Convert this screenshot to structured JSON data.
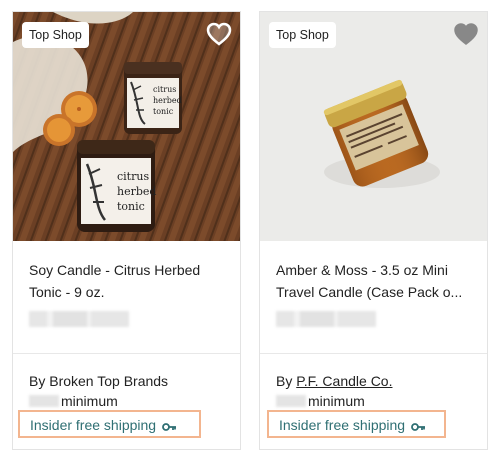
{
  "cards": [
    {
      "badge": "Top Shop",
      "title": "Soy Candle - Citrus Herbed Tonic - 9 oz.",
      "by_label": "By ",
      "brand": "Broken Top Brands",
      "min_label": "minimum",
      "shipping": "Insider free shipping",
      "jar_label_lines": [
        "citrus",
        "herbed",
        "tonic"
      ]
    },
    {
      "badge": "Top Shop",
      "title": "Amber & Moss - 3.5 oz Mini Travel Candle (Case Pack o...",
      "by_label": "By ",
      "brand": "P.F. Candle Co.",
      "min_label": "minimum",
      "shipping": "Insider free shipping"
    }
  ],
  "icons": {
    "favorite": "heart-icon",
    "insider": "key-icon"
  },
  "colors": {
    "shipping_text": "#2f6f73",
    "shipping_border": "#f3b58f"
  }
}
